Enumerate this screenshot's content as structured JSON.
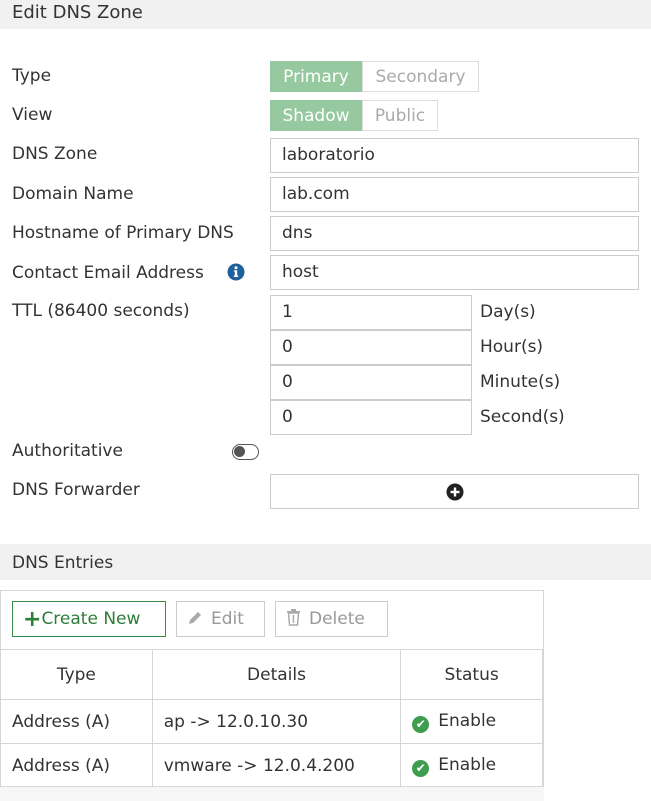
{
  "header": {
    "title": "Edit DNS Zone"
  },
  "form": {
    "type": {
      "label": "Type",
      "options": [
        "Primary",
        "Secondary"
      ],
      "selected": "Primary"
    },
    "view": {
      "label": "View",
      "options": [
        "Shadow",
        "Public"
      ],
      "selected": "Shadow"
    },
    "dns_zone": {
      "label": "DNS Zone",
      "value": "laboratorio"
    },
    "domain_name": {
      "label": "Domain Name",
      "value": "lab.com"
    },
    "primary_dns": {
      "label": "Hostname of Primary DNS",
      "value": "dns"
    },
    "contact_email": {
      "label": "Contact Email Address",
      "value": "host",
      "info_icon": "info-icon"
    },
    "ttl": {
      "label": "TTL (86400 seconds)",
      "days": "1",
      "days_unit": "Day(s)",
      "hours": "0",
      "hours_unit": "Hour(s)",
      "minutes": "0",
      "minutes_unit": "Minute(s)",
      "seconds": "0",
      "seconds_unit": "Second(s)"
    },
    "authoritative": {
      "label": "Authoritative",
      "enabled": false
    },
    "dns_forwarder": {
      "label": "DNS Forwarder",
      "add_icon": "plus-circle-icon"
    }
  },
  "entries": {
    "title": "DNS Entries",
    "toolbar": {
      "create_label": "Create New",
      "edit_label": "Edit",
      "delete_label": "Delete"
    },
    "columns": [
      "Type",
      "Details",
      "Status"
    ],
    "rows": [
      {
        "type": "Address (A)",
        "details": "ap -> 12.0.10.30",
        "status": "Enable"
      },
      {
        "type": "Address (A)",
        "details": "vmware -> 12.0.4.200",
        "status": "Enable"
      }
    ]
  },
  "colors": {
    "accent": "#96c9a0",
    "success": "#3e9d4f",
    "header_bg": "#f1f1f1"
  }
}
